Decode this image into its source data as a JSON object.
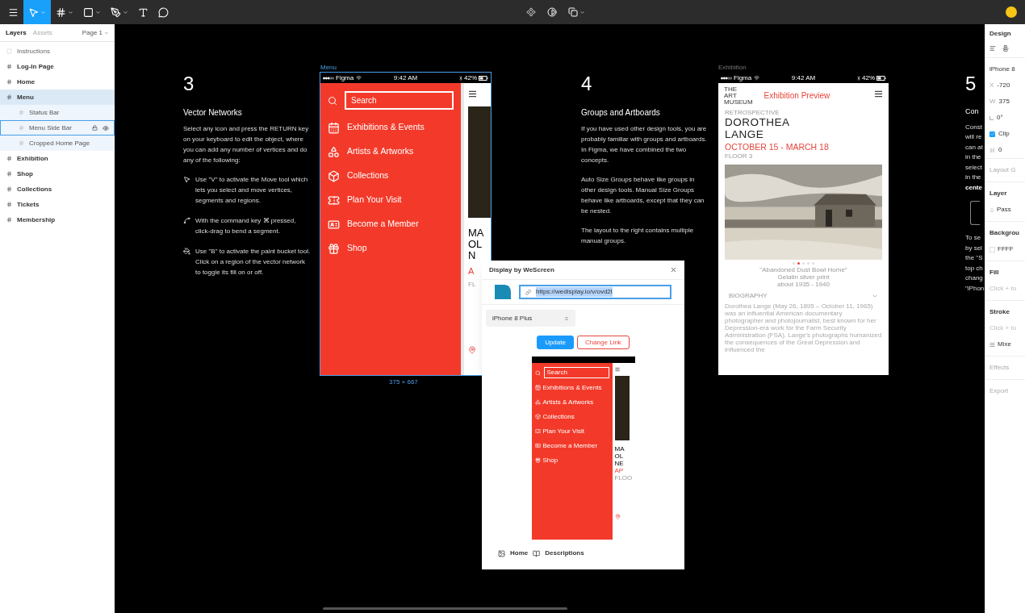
{
  "toolbar": {
    "tools": [
      {
        "kind": "menu",
        "selected": false
      },
      {
        "kind": "move",
        "selected": true
      },
      {
        "kind": "frame",
        "selected": false
      },
      {
        "kind": "rect",
        "selected": false
      },
      {
        "kind": "pen",
        "selected": false
      },
      {
        "kind": "text",
        "selected": false
      },
      {
        "kind": "comment",
        "selected": false
      }
    ],
    "center_tools": [
      {
        "kind": "component"
      },
      {
        "kind": "mask"
      },
      {
        "kind": "boolean"
      }
    ]
  },
  "layers_panel": {
    "tabs": [
      {
        "label": "Layers",
        "selected": true
      },
      {
        "label": "Assets",
        "selected": false
      }
    ],
    "page": "Page 1",
    "layers": [
      {
        "name": "Instructions",
        "kind": "group",
        "selected": false
      },
      {
        "name": "Log-In Page",
        "kind": "frame",
        "selected": false
      },
      {
        "name": "Home",
        "kind": "frame",
        "selected": false
      },
      {
        "name": "Menu",
        "kind": "frame",
        "selected": true,
        "children": [
          {
            "name": "Status Bar",
            "hovered": false
          },
          {
            "name": "Menu Side Bar",
            "hovered": true
          },
          {
            "name": "Cropped Home Page",
            "hovered": false
          }
        ]
      },
      {
        "name": "Exhibition",
        "kind": "frame",
        "selected": false
      },
      {
        "name": "Shop",
        "kind": "frame",
        "selected": false
      },
      {
        "name": "Collections",
        "kind": "frame",
        "selected": false
      },
      {
        "name": "Tickets",
        "kind": "frame",
        "selected": false
      },
      {
        "name": "Membership",
        "kind": "frame",
        "selected": false
      }
    ]
  },
  "instructions": [
    {
      "number": "3",
      "title": "Vector Networks",
      "paragraphs": [
        "Select any icon and press the RETURN key on your keyboard to edit the object, where you can add any number of vertices and do any of the following:"
      ],
      "tips": [
        {
          "kind": "move",
          "text": "Use \"V\" to activate the Move tool which lets you select and move vertices, segments and regions."
        },
        {
          "kind": "bend",
          "text": "With the command key ⌘ pressed, click-drag to bend a segment."
        },
        {
          "kind": "bucket",
          "text": "Use \"B\" to activate the paint bucket tool. Click on a region of the vector network to toggle its fill on or off."
        }
      ]
    },
    {
      "number": "4",
      "title": "Groups and Artboards",
      "paragraphs": [
        "If you have used other design tools, you are probably familiar with groups and artboards. In Figma, we have combined the two concepts.",
        "Auto Size Groups behave like groups in other design tools. Manual Size Groups behave like artboards, except that they can be nested.",
        "The layout to the right contains multiple manual groups."
      ]
    }
  ],
  "column_5": {
    "number": "5",
    "title": "Con",
    "paragraphs": [
      [
        {
          "text": "Const",
          "bold": false
        },
        {
          "text": "will re",
          "bold": false
        },
        {
          "text": "can at",
          "bold": false
        },
        {
          "text": "in the",
          "bold": false
        },
        {
          "text": "select",
          "bold": false
        },
        {
          "text": "in the",
          "bold": false
        },
        {
          "text": "cente",
          "bold": true
        }
      ],
      [
        {
          "text": "To se",
          "bold": false
        },
        {
          "text": "by sel",
          "bold": false
        },
        {
          "text": "the \"S",
          "bold": false
        },
        {
          "text": "top ch",
          "bold": false
        },
        {
          "text": "chang",
          "bold": false
        },
        {
          "text": "\"iPhon",
          "bold": false
        }
      ]
    ]
  },
  "menu_frame": {
    "label": "Menu",
    "selected": true,
    "status": {
      "carrier": "Figma",
      "time": "9:42 AM",
      "battery": "42%"
    },
    "search_placeholder": "Search",
    "items": [
      "Exhibitions & Events",
      "Artists & Artworks",
      "Collections",
      "Plan Your Visit",
      "Become a Member",
      "Shop"
    ],
    "behind": [
      {
        "text": "MA",
        "kind": "title"
      },
      {
        "text": "OL",
        "kind": "title"
      },
      {
        "text": "N",
        "kind": "title"
      },
      {
        "text": "A",
        "kind": "date"
      },
      {
        "text": "FL",
        "kind": "floor"
      }
    ],
    "size": "375 × 667"
  },
  "dialog": {
    "title": "Display by WeScreen",
    "url": "https://wedisplay.io/v/ovd2l",
    "url_selected": true,
    "device": "iPhone 8 Plus",
    "buttons": [
      {
        "label": "Update",
        "kind": "primary"
      },
      {
        "label": "Change Link",
        "kind": "secondary"
      }
    ],
    "preview": {
      "search_placeholder": "Search",
      "items": [
        "Exhibitions & Events",
        "Artists & Artworks",
        "Collections",
        "Plan Your Visit",
        "Become a Member",
        "Shop"
      ],
      "behind": [
        {
          "text": "MA",
          "kind": "title"
        },
        {
          "text": "OL",
          "kind": "title"
        },
        {
          "text": "NE",
          "kind": "title"
        },
        {
          "text": "AP",
          "kind": "date"
        },
        {
          "text": "FLOO",
          "kind": "floor"
        }
      ]
    },
    "footer": [
      "Home",
      "Descriptions"
    ]
  },
  "exhibition_frame": {
    "label": "Exhibition",
    "status": {
      "carrier": "Figma",
      "time": "9:42 AM",
      "battery": "42%"
    },
    "logo": [
      "THE",
      "ART",
      "MUSEUM"
    ],
    "header": "Exhibition Preview",
    "eyebrow": "RETROSPECTIVE",
    "title_lines": [
      "DOROTHEA",
      "LANGE"
    ],
    "dates": "OCTOBER 15 - MARCH 18",
    "floor": "FLOOR 3",
    "carousel": [
      {
        "selected": false
      },
      {
        "selected": true
      },
      {
        "selected": false
      },
      {
        "selected": false
      },
      {
        "selected": false
      }
    ],
    "caption": [
      "\"Abandoned Dust Bowl Home\"",
      "Gelatin silver print",
      "about 1935 - 1940"
    ],
    "section": "BIOGRAPHY",
    "bio": "Dorothea Lange (May 26, 1895 – October 11, 1965) was an influential American documentary photographer and photojournalist, best known for her Depression-era work for the Farm Security Administration (FSA). Lange's photographs humanized the consequences of the Great Depression and influenced the"
  },
  "design_panel": {
    "title": "Design",
    "frame_name": "iPhone 8",
    "fields": [
      {
        "kind": "x",
        "label": "X",
        "value": "-720"
      },
      {
        "kind": "w",
        "label": "W",
        "value": "375"
      },
      {
        "kind": "angle",
        "value": "0°"
      }
    ],
    "clip": {
      "label": "Clip",
      "checked": true
    },
    "radius": "0",
    "sections": [
      {
        "kind": "muted",
        "title": "Layout G"
      },
      {
        "kind": "heading",
        "title": "Layer",
        "rows": [
          {
            "kind": "blend",
            "text": "Pass"
          }
        ]
      },
      {
        "kind": "heading",
        "title": "Backgrou",
        "rows": [
          {
            "kind": "swatch",
            "text": "FFFF"
          }
        ]
      },
      {
        "kind": "heading",
        "title": "Fill",
        "rows": [
          {
            "kind": "hint",
            "text": "Click + to"
          }
        ]
      },
      {
        "kind": "heading",
        "title": "Stroke",
        "rows": [
          {
            "kind": "hint",
            "text": "Click + to"
          },
          {
            "kind": "weight",
            "text": "Mixe"
          }
        ]
      },
      {
        "kind": "muted",
        "title": "Effects"
      },
      {
        "kind": "muted",
        "title": "Export"
      }
    ]
  }
}
